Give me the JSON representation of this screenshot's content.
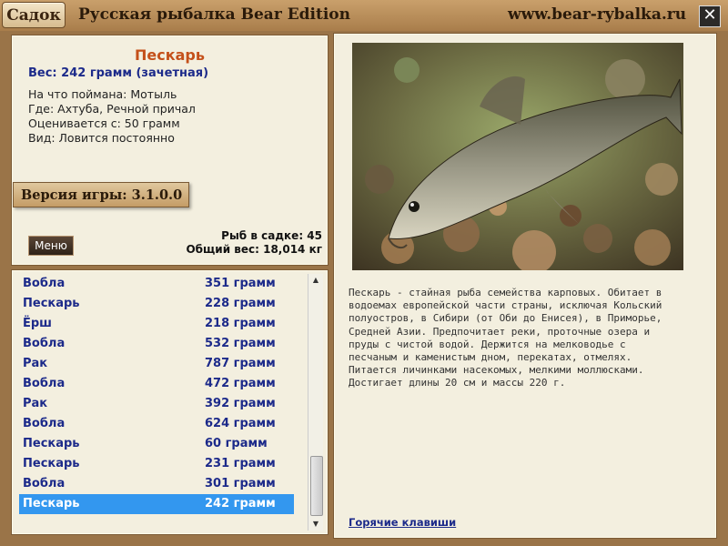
{
  "window": {
    "tab_label": "Садок",
    "title": "Русская рыбалка Bear Edition",
    "site": "www.bear-rybalka.ru",
    "close_label": "✕"
  },
  "fish": {
    "name": "Пескарь",
    "weight": "Вес: 242 грамм (зачетная)",
    "caught_with": "На что поймана: Мотыль",
    "location": "Где: Ахтуба, Речной причал",
    "rated_from": "Оценивается с: 50 грамм",
    "kind": "Вид: Ловится постоянно"
  },
  "version": "Версия игры: 3.1.0.0",
  "menu_label": "Меню",
  "stats": {
    "fish_count": "Рыб в садке: 45",
    "total_weight": "Общий вес: 18,014 кг"
  },
  "catch_list": [
    {
      "name": "Вобла",
      "weight": "351 грамм"
    },
    {
      "name": "Пескарь",
      "weight": "228 грамм"
    },
    {
      "name": "Ёрш",
      "weight": "218 грамм"
    },
    {
      "name": "Вобла",
      "weight": "532 грамм"
    },
    {
      "name": "Рак",
      "weight": "787 грамм"
    },
    {
      "name": "Вобла",
      "weight": "472 грамм"
    },
    {
      "name": "Рак",
      "weight": "392 грамм"
    },
    {
      "name": "Вобла",
      "weight": "624 грамм"
    },
    {
      "name": "Пескарь",
      "weight": "60 грамм"
    },
    {
      "name": "Пескарь",
      "weight": "231 грамм"
    },
    {
      "name": "Вобла",
      "weight": "301 грамм"
    },
    {
      "name": "Пескарь",
      "weight": "242 грамм",
      "selected": true
    }
  ],
  "description_lines": [
    "Пескарь - стайная рыба семейства карповых. Обитает в",
    "водоемах европейской части страны, исключая Кольский",
    "полуостров, в Сибири (от Оби до Енисея), в Приморье,",
    "Средней Азии. Предпочитает реки, проточные озера и",
    "пруды с чистой водой. Держится на мелководье с",
    "песчаным и каменистым дном, перекатах, отмелях.",
    "Питается личинками насекомых, мелкими моллюсками.",
    "Достигает длины 20 см и массы 220 г."
  ],
  "hotkeys_label": "Горячие клавиши",
  "colors": {
    "accent": "#c4501a",
    "list_text": "#1c2a8a",
    "selection": "#3397ef"
  },
  "icons": {
    "close": "close-icon",
    "scroll_up": "arrow-up-icon",
    "scroll_down": "arrow-down-icon"
  }
}
